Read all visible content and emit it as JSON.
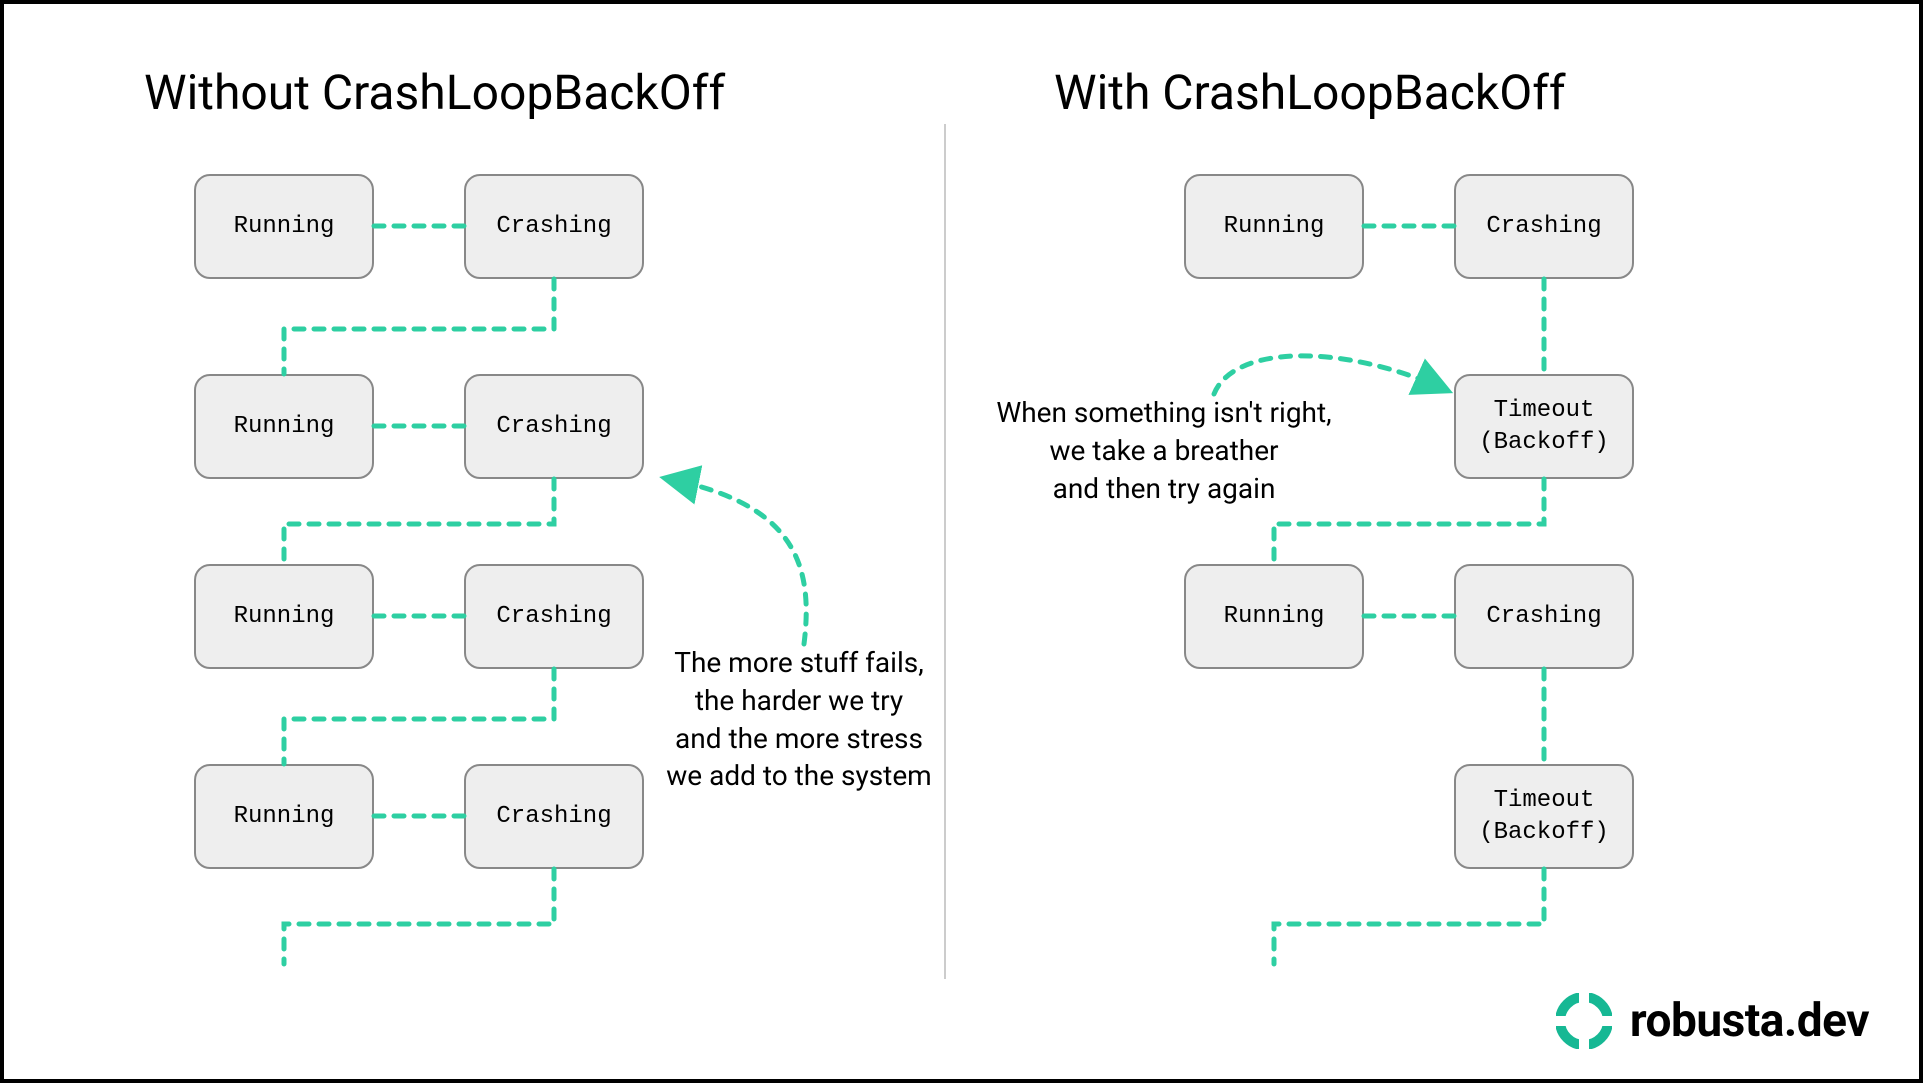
{
  "colors": {
    "accent": "#2ecfa2",
    "node_bg": "#eeeeee",
    "node_border": "#888888",
    "divider": "#cccccc"
  },
  "left": {
    "title": "Without CrashLoopBackOff",
    "rows": [
      {
        "a": "Running",
        "b": "Crashing"
      },
      {
        "a": "Running",
        "b": "Crashing"
      },
      {
        "a": "Running",
        "b": "Crashing"
      },
      {
        "a": "Running",
        "b": "Crashing"
      }
    ],
    "annotation_lines": [
      "The more stuff fails,",
      "the harder we try",
      "and the more stress",
      "we add to the system"
    ]
  },
  "right": {
    "title": "With CrashLoopBackOff",
    "rows": [
      {
        "a": "Running",
        "b": "Crashing"
      },
      {
        "a": "",
        "b": "Timeout\n(Backoff)"
      },
      {
        "a": "Running",
        "b": "Crashing"
      },
      {
        "a": "",
        "b": "Timeout\n(Backoff)"
      }
    ],
    "annotation_lines": [
      "When something isn't right,",
      "we take a breather",
      "and then try again"
    ]
  },
  "brand": "robusta.dev"
}
